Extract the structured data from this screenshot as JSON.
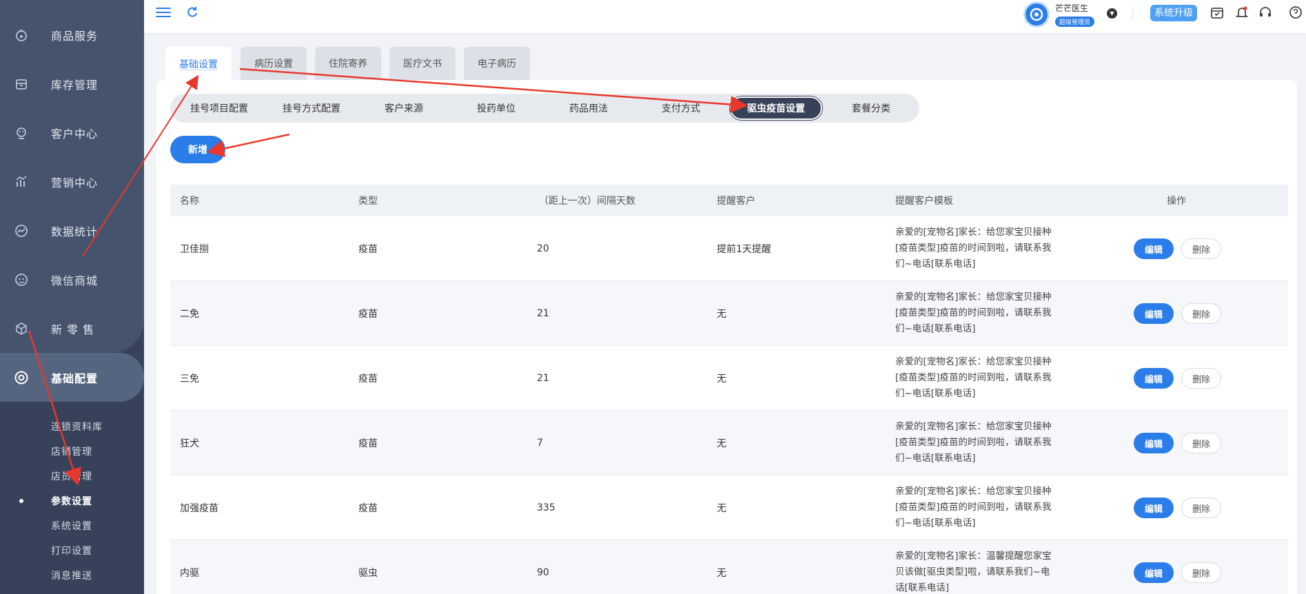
{
  "sidebar": {
    "items": [
      {
        "label": "商品服务",
        "icon": "bag-icon"
      },
      {
        "label": "库存管理",
        "icon": "box-icon"
      },
      {
        "label": "客户中心",
        "icon": "customer-icon"
      },
      {
        "label": "营销中心",
        "icon": "marketing-icon"
      },
      {
        "label": "数据统计",
        "icon": "chart-icon"
      },
      {
        "label": "微信商城",
        "icon": "wechat-icon"
      },
      {
        "label": "新 零 售",
        "icon": "cube-icon"
      },
      {
        "label": "基础配置",
        "icon": "settings-icon"
      }
    ],
    "sub_items": [
      {
        "label": "连锁资料库"
      },
      {
        "label": "店铺管理"
      },
      {
        "label": "店员管理"
      },
      {
        "label": "参数设置"
      },
      {
        "label": "系统设置"
      },
      {
        "label": "打印设置"
      },
      {
        "label": "消息推送"
      }
    ]
  },
  "header": {
    "user_name": "芒芒医生",
    "user_role": "超级管理员",
    "upgrade_label": "系统升级"
  },
  "top_tabs": [
    {
      "label": "基础设置"
    },
    {
      "label": "病历设置"
    },
    {
      "label": "住院寄养"
    },
    {
      "label": "医疗文书"
    },
    {
      "label": "电子病历"
    }
  ],
  "sub_tabs": [
    {
      "label": "挂号项目配置"
    },
    {
      "label": "挂号方式配置"
    },
    {
      "label": "客户来源"
    },
    {
      "label": "投药单位"
    },
    {
      "label": "药品用法"
    },
    {
      "label": "支付方式"
    },
    {
      "label": "驱虫疫苗设置"
    },
    {
      "label": "套餐分类"
    }
  ],
  "add_button": "新增",
  "table": {
    "headers": [
      "名称",
      "类型",
      "（距上一次）间隔天数",
      "提醒客户",
      "提醒客户模板",
      "操作"
    ],
    "rows": [
      {
        "name": "卫佳捌",
        "type": "疫苗",
        "days": "20",
        "remind": "提前1天提醒",
        "tpl": [
          "亲爱的[宠物名]家长：给您家宝贝接种",
          "[疫苗类型]疫苗的时间到啦，请联系我",
          "们~电话[联系电话]"
        ]
      },
      {
        "name": "二免",
        "type": "疫苗",
        "days": "21",
        "remind": "无",
        "tpl": [
          "亲爱的[宠物名]家长：给您家宝贝接种",
          "[疫苗类型]疫苗的时间到啦，请联系我",
          "们~电话[联系电话]"
        ]
      },
      {
        "name": "三免",
        "type": "疫苗",
        "days": "21",
        "remind": "无",
        "tpl": [
          "亲爱的[宠物名]家长：给您家宝贝接种",
          "[疫苗类型]疫苗的时间到啦，请联系我",
          "们~电话[联系电话]"
        ]
      },
      {
        "name": "狂犬",
        "type": "疫苗",
        "days": "7",
        "remind": "无",
        "tpl": [
          "亲爱的[宠物名]家长：给您家宝贝接种",
          "[疫苗类型]疫苗的时间到啦，请联系我",
          "们~电话[联系电话]"
        ]
      },
      {
        "name": "加强疫苗",
        "type": "疫苗",
        "days": "335",
        "remind": "无",
        "tpl": [
          "亲爱的[宠物名]家长：给您家宝贝接种",
          "[疫苗类型]疫苗的时间到啦，请联系我",
          "们~电话[联系电话]"
        ]
      },
      {
        "name": "内驱",
        "type": "驱虫",
        "days": "90",
        "remind": "无",
        "tpl": [
          "亲爱的[宠物名]家长：温馨提醒您家宝",
          "贝该做[驱虫类型]啦，请联系我们~电",
          "话[联系电话]"
        ]
      }
    ],
    "edit_label": "编辑",
    "delete_label": "删除"
  },
  "colors": {
    "accent": "#2b7de9",
    "sidebar": "#45536d",
    "arrow": "#e8372c"
  }
}
